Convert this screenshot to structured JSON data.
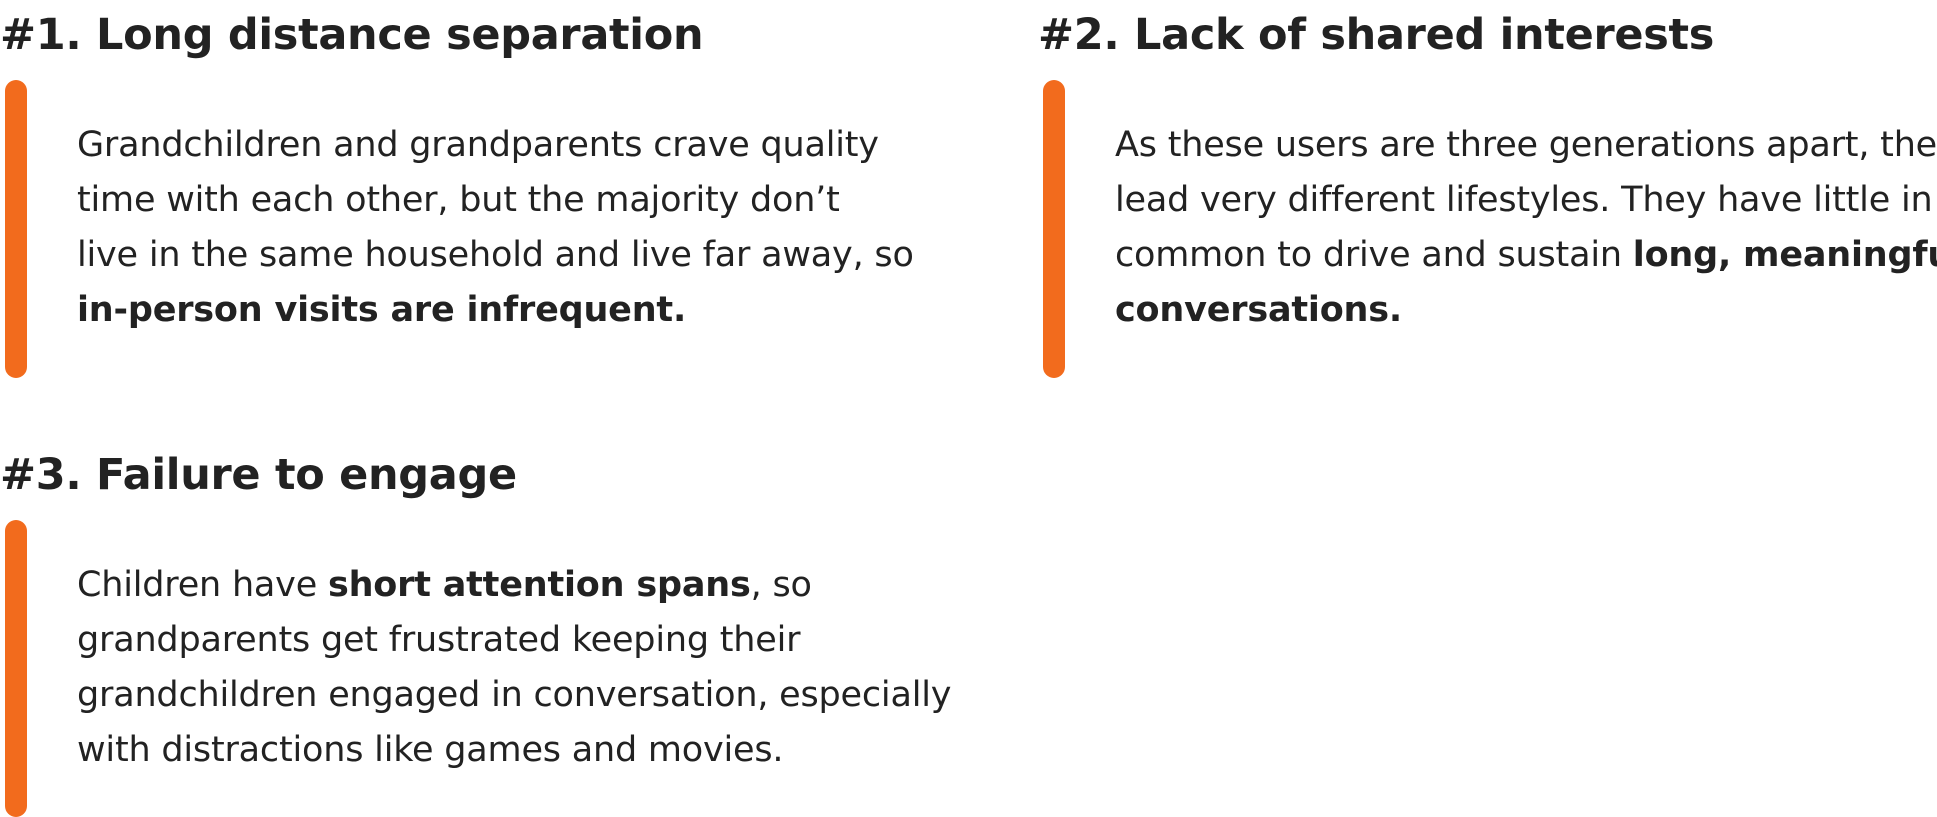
{
  "colors": {
    "accent": "#f26b1d",
    "text": "#222222",
    "background": "#ffffff"
  },
  "problems": [
    {
      "title": "#1. Long distance separation",
      "body": [
        [
          {
            "text": "Grandchildren and grandparents crave quality"
          }
        ],
        [
          {
            "text": "time with each other, but the majority don’t"
          }
        ],
        [
          {
            "text": "live in the same household and live far away, so"
          }
        ],
        [
          {
            "text": "in-person visits are infrequent.",
            "bold": true
          }
        ]
      ]
    },
    {
      "title": "#2. Lack of shared interests",
      "body": [
        [
          {
            "text": "As these users are three generations apart, they"
          }
        ],
        [
          {
            "text": "lead very different lifestyles. They have little in"
          }
        ],
        [
          {
            "text": "common to drive and sustain "
          },
          {
            "text": "long, meaningful",
            "bold": true
          }
        ],
        [
          {
            "text": "conversations.",
            "bold": true
          }
        ]
      ]
    },
    {
      "title": "#3. Failure to engage",
      "body": [
        [
          {
            "text": "Children have "
          },
          {
            "text": "short attention spans",
            "bold": true
          },
          {
            "text": ", so"
          }
        ],
        [
          {
            "text": "grandparents get frustrated keeping their"
          }
        ],
        [
          {
            "text": "grandchildren engaged in conversation, especially"
          }
        ],
        [
          {
            "text": "with distractions like games and movies."
          }
        ]
      ]
    }
  ]
}
